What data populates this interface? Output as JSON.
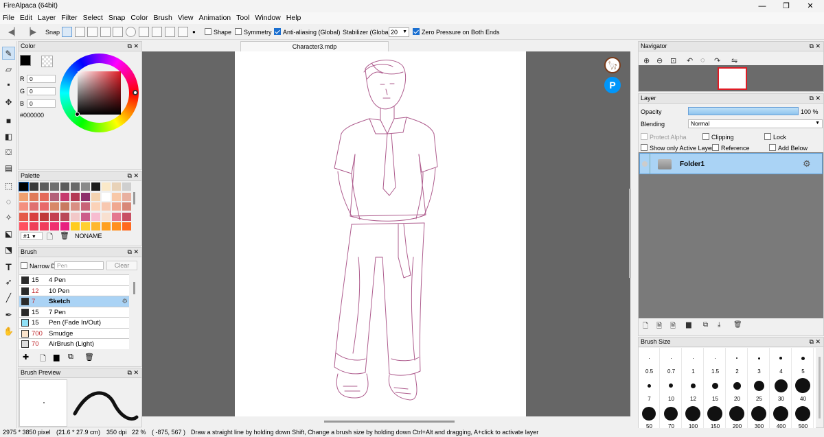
{
  "window": {
    "title": "FireAlpaca (64bit)",
    "min": "—",
    "max": "❐",
    "close": "✕"
  },
  "menu": [
    "File",
    "Edit",
    "Layer",
    "Filter",
    "Select",
    "Snap",
    "Color",
    "Brush",
    "View",
    "Animation",
    "Tool",
    "Window",
    "Help"
  ],
  "toolbar": {
    "snap": "Snap",
    "shape": "Shape",
    "symmetry": "Symmetry",
    "antialias": "Anti-aliasing (Global)",
    "stabilizer_label": "Stabilizer (Global)",
    "stabilizer_value": "20",
    "zero_pressure": "Zero Pressure on Both Ends"
  },
  "document": {
    "tab": "Character3.mdp"
  },
  "color_panel": {
    "title": "Color",
    "r_label": "R",
    "r": "0",
    "g_label": "G",
    "g": "0",
    "b_label": "B",
    "b": "0",
    "hex": "#000000"
  },
  "palette_panel": {
    "title": "Palette",
    "index": "#1",
    "name": "NONAME",
    "colors": [
      "#000000",
      "#3a3a3a",
      "#5e5e5e",
      "#6f6f6f",
      "#5c5c5c",
      "#696969",
      "#8a8a8a",
      "#1a1a1a",
      "#fbe9c9",
      "#e8d2b8",
      "#cfcfcf",
      "#f0a070",
      "#e07b5a",
      "#e46a5a",
      "#b46078",
      "#c63a6e",
      "#b43a55",
      "#8e2f6b",
      "#f4d3b0",
      "#ffffff",
      "#f8c8a8",
      "#e8b0a0",
      "#f49080",
      "#e07070",
      "#e86a6a",
      "#d88868",
      "#c97a60",
      "#d98f84",
      "#c86478",
      "#fbd2b8",
      "#f8c8b0",
      "#f0a890",
      "#d88878",
      "#e45a4a",
      "#d84040",
      "#c03a3a",
      "#c43f50",
      "#ba4858",
      "#f2c8c8",
      "#cc5c8a",
      "#f7bcd0",
      "#f8e0d0",
      "#e47890",
      "#c85064",
      "#ff5060",
      "#ee4058",
      "#f03c5c",
      "#f03070",
      "#e82080",
      "#ffcc20",
      "#ffd030",
      "#ffb830",
      "#ffa020",
      "#ff9020",
      "#ff6a20"
    ]
  },
  "brush_panel": {
    "title": "Brush",
    "narrow_label": "Narrow D",
    "search_placeholder": "Pen",
    "clear": "Clear",
    "items": [
      {
        "size": "15",
        "name": "4 Pen",
        "color": "#2a2a2a",
        "sizecolor": "#000"
      },
      {
        "size": "12",
        "name": "10 Pen",
        "color": "#2a2a2a",
        "sizecolor": "#c0282d"
      },
      {
        "size": "7",
        "name": "Sketch",
        "color": "#2a2a2a",
        "sizecolor": "#c0282d"
      },
      {
        "size": "15",
        "name": "7 Pen",
        "color": "#2a2a2a",
        "sizecolor": "#000"
      },
      {
        "size": "15",
        "name": "Pen (Fade In/Out)",
        "color": "#8fe0f6",
        "sizecolor": "#000"
      },
      {
        "size": "700",
        "name": "Smudge",
        "color": "#fbe4cc",
        "sizecolor": "#c0282d"
      },
      {
        "size": "70",
        "name": "AirBrush (Light)",
        "color": "#dddddd",
        "sizecolor": "#c0282d"
      }
    ]
  },
  "brush_preview": {
    "title": "Brush Preview"
  },
  "navigator": {
    "title": "Navigator"
  },
  "layer_panel": {
    "title": "Layer",
    "opacity_label": "Opacity",
    "opacity_value": "100 %",
    "opacity": 1.0,
    "blending_label": "Blending",
    "blending_value": "Normal",
    "protect_alpha": "Protect Alpha",
    "clipping": "Clipping",
    "lock": "Lock",
    "show_only_active": "Show only Active Layer",
    "reference": "Reference",
    "add_below": "Add Below",
    "layers": [
      {
        "name": "Folder1"
      }
    ]
  },
  "brush_size_panel": {
    "title": "Brush Size",
    "sizes": [
      "0.5",
      "0.7",
      "1",
      "1.5",
      "2",
      "3",
      "4",
      "5",
      "7",
      "10",
      "12",
      "15",
      "20",
      "25",
      "30",
      "40",
      "50",
      "70",
      "100",
      "150",
      "200",
      "300",
      "400",
      "500"
    ]
  },
  "status": {
    "pixels": "2975 * 3850 pixel",
    "physical": "(21.6 * 27.9 cm)",
    "dpi": "350 dpi",
    "zoom": "22 %",
    "coords": "( -875, 567 )",
    "hint": "Draw a straight line by holding down Shift, Change a brush size by holding down Ctrl+Alt and dragging, A+click to activate layer"
  },
  "icons": {
    "alpaca": "alpaca-logo-icon",
    "pixiv": "pixiv-logo-icon",
    "pixiv_letter": "P"
  },
  "colors": {
    "accent": "#1a6fd0",
    "selection": "#aad3f5",
    "canvas_bg": "#666666",
    "sketch_line": "#a0407a"
  }
}
